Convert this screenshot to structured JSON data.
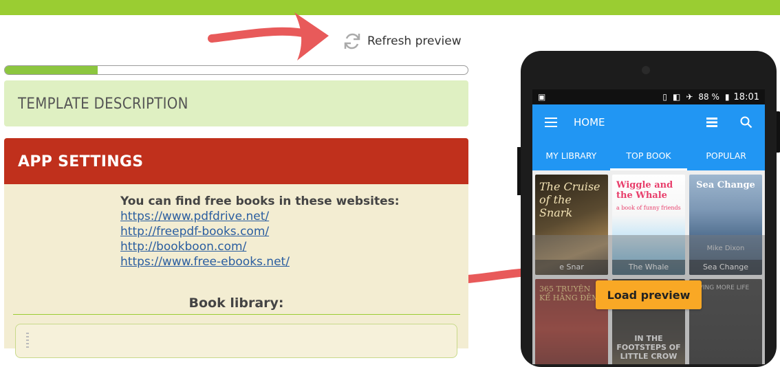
{
  "header": {
    "refresh_label": "Refresh preview"
  },
  "progress": {
    "percent": 20
  },
  "template_section": {
    "title": "TEMPLATE DESCRIPTION"
  },
  "app_settings": {
    "title": "APP SETTINGS",
    "lead": "You can find free books in these websites:",
    "links": [
      "https://www.pdfdrive.net/",
      "http://freepdf-books.com/",
      "http://bookboon.com/",
      "https://www.free-ebooks.net/"
    ],
    "library_title": "Book library:"
  },
  "phone": {
    "status": {
      "battery": "88 %",
      "time": "18:01"
    },
    "appbar_title": "HOME",
    "tabs": [
      "MY LIBRARY",
      "TOP BOOK",
      "POPULAR"
    ],
    "active_tab": "TOP BOOK",
    "books": [
      {
        "cover": "The Cruise of the Snark",
        "label": "e Snar"
      },
      {
        "cover": "Wiggle and the Whale",
        "sub": "a book of funny friends",
        "label": "The Whale"
      },
      {
        "cover": "Sea Change",
        "author": "Mike Dixon",
        "label": "Sea Change"
      },
      {
        "cover": "365 TRUYỆN KỂ HẰNG ĐÊM",
        "label": ""
      },
      {
        "cover": "IN THE FOOTSTEPS OF LITTLE CROW",
        "label": ""
      },
      {
        "cover": "LIVING MORE LIFE",
        "label": ""
      }
    ],
    "load_preview_label": "Load preview"
  },
  "colors": {
    "accent_green": "#9acd32",
    "red_header": "#c0301c",
    "app_blue": "#2196f3",
    "button_orange": "#f9a825"
  }
}
